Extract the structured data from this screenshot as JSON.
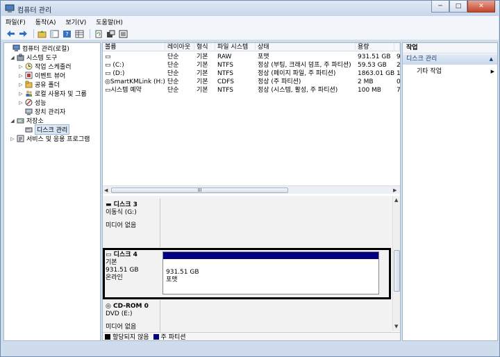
{
  "window": {
    "title": "컴퓨터 관리",
    "min": "─",
    "max": "□",
    "close": "✕"
  },
  "menu": [
    "파일(F)",
    "동작(A)",
    "보기(V)",
    "도움말(H)"
  ],
  "tree": [
    {
      "label": "컴퓨터 관리(로컬)",
      "indent": 0,
      "exp": "",
      "icon": "computer-icon"
    },
    {
      "label": "시스템 도구",
      "indent": 1,
      "exp": "◢",
      "icon": "tools-icon"
    },
    {
      "label": "작업 스케줄러",
      "indent": 2,
      "exp": "▷",
      "icon": "clock-icon"
    },
    {
      "label": "이벤트 뷰어",
      "indent": 2,
      "exp": "▷",
      "icon": "event-icon"
    },
    {
      "label": "공유 폴더",
      "indent": 2,
      "exp": "▷",
      "icon": "folder-icon"
    },
    {
      "label": "로컬 사용자 및 그룹",
      "indent": 2,
      "exp": "▷",
      "icon": "users-icon"
    },
    {
      "label": "성능",
      "indent": 2,
      "exp": "▷",
      "icon": "performance-icon"
    },
    {
      "label": "장치 관리자",
      "indent": 2,
      "exp": "",
      "icon": "device-icon"
    },
    {
      "label": "저장소",
      "indent": 1,
      "exp": "◢",
      "icon": "storage-icon"
    },
    {
      "label": "디스크 관리",
      "indent": 2,
      "exp": "",
      "icon": "disk-icon",
      "selected": true
    },
    {
      "label": "서비스 및 응용 프로그램",
      "indent": 1,
      "exp": "▷",
      "icon": "services-icon"
    }
  ],
  "volumes": {
    "columns": [
      "볼륨",
      "레이아웃",
      "형식",
      "파일 시스템",
      "상태",
      "용량",
      ""
    ],
    "rows": [
      [
        "",
        "단순",
        "기본",
        "RAW",
        "포맷",
        "931.51 GB",
        "9"
      ],
      [
        "(C:)",
        "단순",
        "기본",
        "NTFS",
        "정상 (부팅, 크래시 덤프, 주 파티션)",
        "59.53 GB",
        "2"
      ],
      [
        "(D:)",
        "단순",
        "기본",
        "NTFS",
        "정상 (페이지 파일, 주 파티션)",
        "1863.01 GB",
        "1"
      ],
      [
        "SmartKMLink (H:)",
        "단순",
        "기본",
        "CDFS",
        "정상 (주 파티션)",
        "2 MB",
        "0"
      ],
      [
        "시스템 예약",
        "단순",
        "기본",
        "NTFS",
        "정상 (시스템, 활성, 주 파티션)",
        "100 MB",
        "7"
      ]
    ],
    "scroll_grip": "III"
  },
  "disks": [
    {
      "name": "디스크 3",
      "line1": "이동식 (G:)",
      "line2": "",
      "line3": "미디어 없음",
      "partition": null
    },
    {
      "name": "디스크 4",
      "line1": "기본",
      "line2": "931.51 GB",
      "line3": "온라인",
      "partition": {
        "size": "931.51 GB",
        "status": "포맷"
      }
    },
    {
      "name": "CD-ROM 0",
      "line1": "DVD (E:)",
      "line2": "",
      "line3": "미디어 없음",
      "partition": null
    }
  ],
  "legend": {
    "unallocated": "할당되지 않음",
    "primary": "주 파티션",
    "unallocated_color": "#000000",
    "primary_color": "#000080"
  },
  "actions": {
    "header": "작업",
    "section": "디스크 관리",
    "item": "기타 작업",
    "item_arrow": "▶",
    "section_arrow": "▲"
  },
  "colors": {
    "accent": "#000080",
    "selection": "#d9e6f6"
  }
}
